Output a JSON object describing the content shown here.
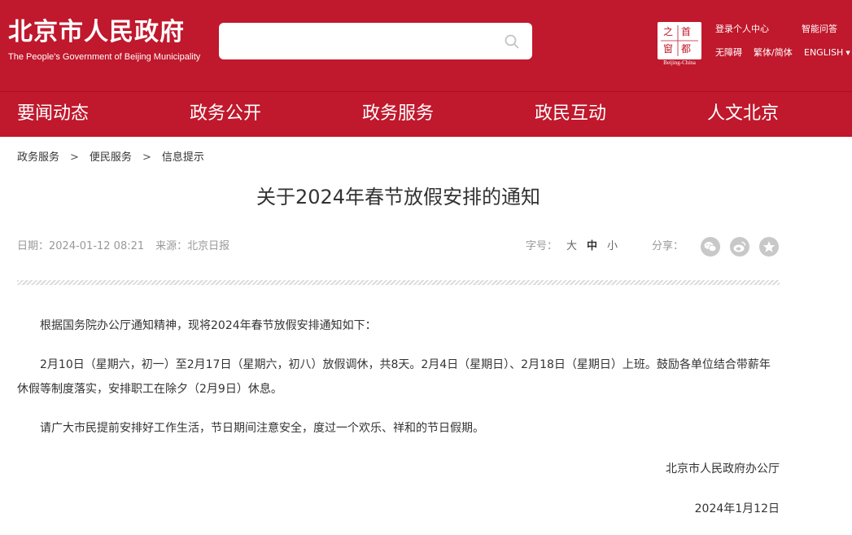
{
  "header": {
    "logo_cn": "北京市人民政府",
    "logo_en": "The People's Government of Beijing Municipality",
    "search": {
      "value": "",
      "placeholder": ""
    },
    "seal": {
      "chars": [
        "首",
        "都",
        "之",
        "窗"
      ],
      "caption": "Beijing-China"
    },
    "links": {
      "login": "登录个人中心",
      "smart_qa": "智能问答",
      "accessibility": "无障碍",
      "trad_simp": "繁体/简体",
      "english": "ENGLISH"
    }
  },
  "nav": {
    "items": [
      "要闻动态",
      "政务公开",
      "政务服务",
      "政民互动",
      "人文北京"
    ]
  },
  "breadcrumb": {
    "items": [
      "政务服务",
      "便民服务",
      "信息提示"
    ],
    "separator": ">"
  },
  "article": {
    "title": "关于2024年春节放假安排的通知",
    "date": "日期：2024-01-12 08:21",
    "source": "来源：北京日报",
    "font_size_label": "字号：",
    "font_sizes": [
      "大",
      "中",
      "小"
    ],
    "share_label": "分享：",
    "share_icons": [
      "wechat-icon",
      "weibo-icon",
      "favorite-icon"
    ],
    "paragraphs": [
      "根据国务院办公厅通知精神，现将2024年春节放假安排通知如下：",
      "2月10日（星期六，初一）至2月17日（星期六，初八）放假调休，共8天。2月4日（星期日）、2月18日（星期日）上班。鼓励各单位结合带薪年休假等制度落实，安排职工在除夕（2月9日）休息。",
      "请广大市民提前安排好工作生活，节日期间注意安全，度过一个欢乐、祥和的节日假期。"
    ],
    "signature": "北京市人民政府办公厅",
    "sign_date": "2024年1月12日"
  },
  "colors": {
    "brand_red": "#c0182c",
    "text": "#333333",
    "muted": "#999999"
  }
}
